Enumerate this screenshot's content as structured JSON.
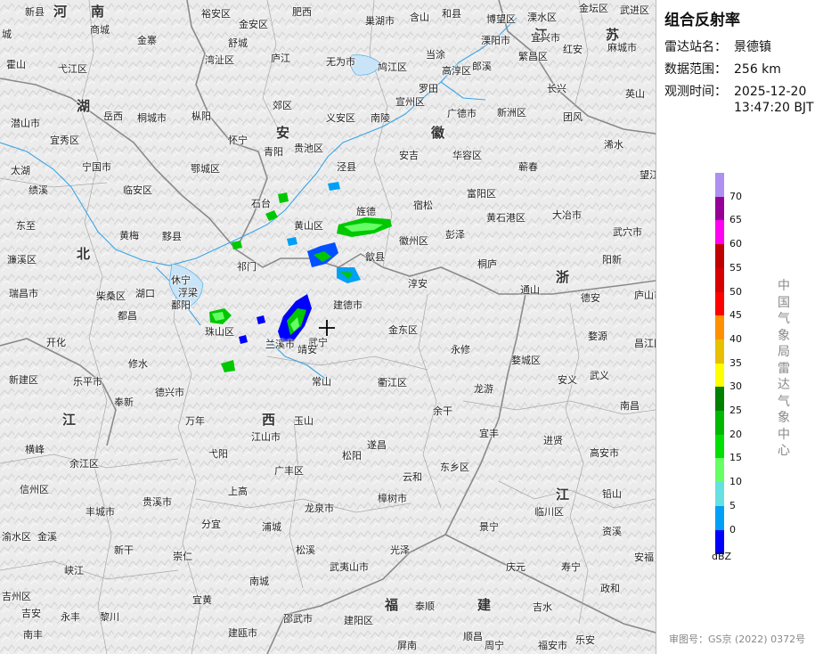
{
  "panel": {
    "title": "组合反射率",
    "station_label": "雷达站名：",
    "station": "景德镇",
    "range_label": "数据范围：",
    "range": "256 km",
    "time_label": "观测时间：",
    "date": "2025-12-20",
    "time": "13:47:20 BJT",
    "unit": "dBZ",
    "org": "中国气象局雷达气象中心",
    "approval": "审图号：GS京 (2022) 0372号"
  },
  "legend": {
    "ticks": [
      "70",
      "65",
      "60",
      "55",
      "50",
      "45",
      "40",
      "35",
      "30",
      "25",
      "20",
      "15",
      "10",
      "5",
      "0"
    ],
    "colors": [
      "#ad90f0",
      "#960096",
      "#ff00f0",
      "#c00000",
      "#d60000",
      "#ff0000",
      "#ff9000",
      "#e7c000",
      "#ffff00",
      "#008000",
      "#00b800",
      "#00e000",
      "#66ff66",
      "#66e0e0",
      "#00a0f6",
      "#0000ff"
    ]
  },
  "provinces": [
    "河",
    "南",
    "湖",
    "北",
    "安",
    "徽",
    "江",
    "苏",
    "浙",
    "江",
    "西",
    "福",
    "建",
    "江"
  ],
  "places": [
    "新县",
    "城",
    "裕安区",
    "金安区",
    "肥西",
    "巢湖市",
    "含山",
    "和县",
    "博望区",
    "溧水区",
    "金坛区",
    "武进区",
    "商城",
    "金寨",
    "舒城",
    "庐江",
    "无为市",
    "鸠江区",
    "当涂",
    "溧阳市",
    "宜兴市",
    "红安",
    "麻城市",
    "霍山",
    "弋江区",
    "湾沚区",
    "高淳区",
    "郎溪",
    "繁昌区",
    "长兴",
    "罗田",
    "英山",
    "岳西",
    "桐城市",
    "枞阳",
    "郊区",
    "义安区",
    "南陵",
    "宣州区",
    "广德市",
    "新洲区",
    "团风",
    "潜山市",
    "宜秀区",
    "怀宁",
    "贵池区",
    "青阳",
    "泾县",
    "安吉",
    "华容区",
    "浠水",
    "太湖",
    "宁国市",
    "鄂城区",
    "蕲春",
    "绩溪",
    "临安区",
    "黄石港区",
    "大冶市",
    "望江",
    "东至",
    "石台",
    "黄山区",
    "旌德",
    "宿松",
    "富阳区",
    "武穴市",
    "黄梅",
    "黟县",
    "徽州区",
    "彭泽",
    "祁门",
    "歙县",
    "桐庐",
    "阳新",
    "濂溪区",
    "休宁",
    "淳安",
    "通山",
    "瑞昌市",
    "柴桑区",
    "湖口",
    "浮梁",
    "建德市",
    "德安",
    "庐山市",
    "都昌",
    "鄱阳",
    "珠山区",
    "兰溪市",
    "武宁",
    "婺源",
    "开化",
    "金东区",
    "永修",
    "昌江区",
    "修水",
    "靖安",
    "新建区",
    "乐平市",
    "德兴市",
    "常山",
    "衢江区",
    "龙游",
    "婺城区",
    "安义",
    "武义",
    "奉新",
    "南昌",
    "万年",
    "玉山",
    "余干",
    "江山市",
    "宜丰",
    "横峰",
    "遂昌",
    "进贤",
    "弋阳",
    "松阳",
    "高安市",
    "余江区",
    "广丰区",
    "东乡区",
    "上高",
    "信州区",
    "云和",
    "铅山",
    "樟树市",
    "丰城市",
    "贵溪市",
    "龙泉市",
    "临川区",
    "分宜",
    "渝水区",
    "金溪",
    "浦城",
    "景宁",
    "资溪",
    "新干",
    "崇仁",
    "松溪",
    "庆元",
    "光泽",
    "武夷山市",
    "峡江",
    "南城",
    "吉安",
    "宜黄",
    "寿宁",
    "政和",
    "吉水",
    "永丰",
    "黎川",
    "邵武市",
    "建阳区",
    "泰顺",
    "安福",
    "吉州区",
    "南丰",
    "建瓯市",
    "顺昌",
    "屏南",
    "周宁",
    "福安市",
    "乐安"
  ]
}
